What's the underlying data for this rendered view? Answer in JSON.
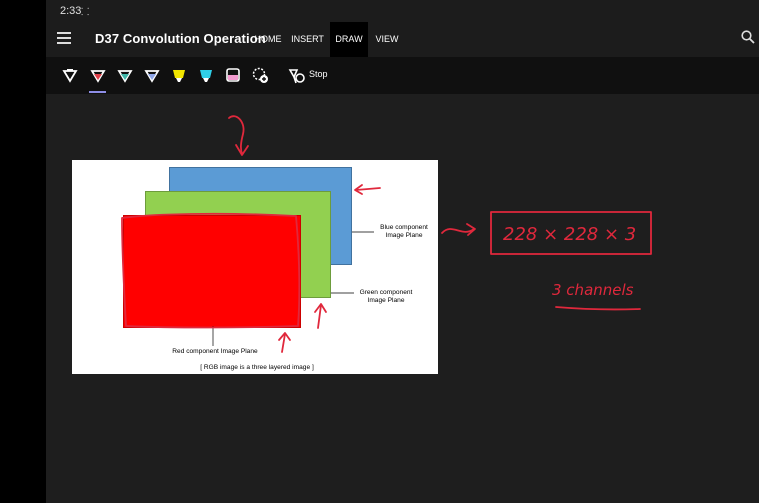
{
  "status": {
    "time": "2:33",
    "indicator": "⸬"
  },
  "app": {
    "title": "D37 Convolution Operation"
  },
  "tabs": [
    {
      "label": "HOME"
    },
    {
      "label": "INSERT"
    },
    {
      "label": "DRAW"
    },
    {
      "label": "VIEW"
    }
  ],
  "active_tab": "DRAW",
  "toolbar": {
    "tools": [
      {
        "icon": "pen-white-icon",
        "color": "#ffffff"
      },
      {
        "icon": "pen-red-icon",
        "color": "#e0404a"
      },
      {
        "icon": "pen-teal-icon",
        "color": "#3fb6a8"
      },
      {
        "icon": "pen-blue-icon",
        "color": "#8fa6e8"
      },
      {
        "icon": "highlighter-yellow-icon",
        "color": "#f2e600"
      },
      {
        "icon": "highlighter-cyan-icon",
        "color": "#2fd0e8"
      },
      {
        "icon": "highlighter-pink-icon",
        "color": "#f39bd0"
      },
      {
        "icon": "add-pen-icon",
        "color": "#ffffff"
      }
    ],
    "stop_label": "Stop"
  },
  "slide": {
    "blue_label": "Blue component Image Plane",
    "green_label": "Green component Image Plane",
    "red_label": "Red component Image Plane",
    "caption": "[ RGB image is a three layered image ]",
    "colors": {
      "red": "#ff0000",
      "green": "#92d050",
      "blue": "#5b9bd5"
    }
  },
  "annotations": {
    "dimensions": "228 × 228 × 3",
    "channels": "3 channels",
    "ink_color": "#e0283c"
  }
}
